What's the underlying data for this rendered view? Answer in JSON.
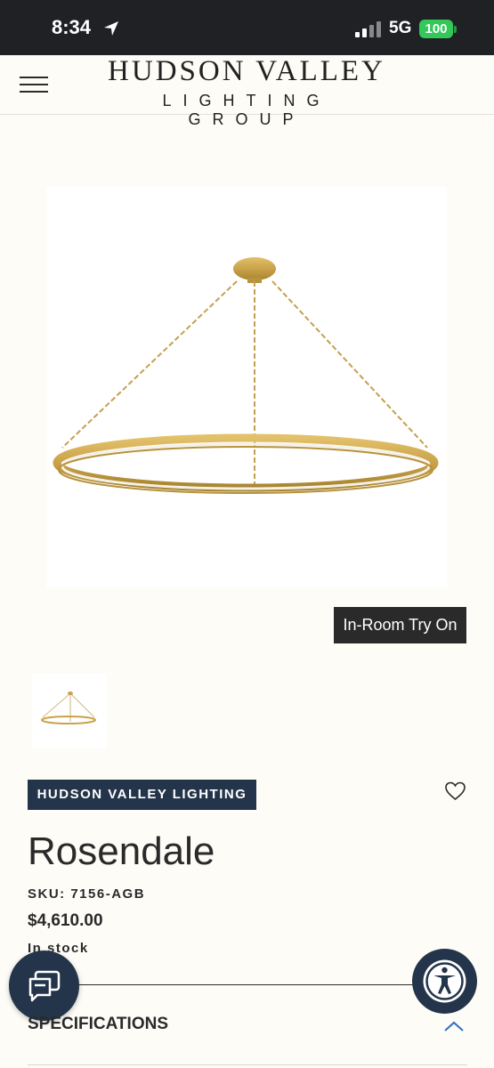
{
  "status_bar": {
    "time": "8:34",
    "network": "5G",
    "battery": "100"
  },
  "header": {
    "brand_top": "HUDSON VALLEY",
    "brand_bottom": "LIGHTING GROUP"
  },
  "product": {
    "try_on_label": "In-Room Try On",
    "brand_badge": "HUDSON VALLEY LIGHTING",
    "name": "Rosendale",
    "sku": "SKU: 7156-AGB",
    "price": "$4,610.00",
    "stock": "In stock"
  },
  "sections": {
    "specifications_label": "SPECIFICATIONS"
  },
  "colors": {
    "status_bar_bg": "#1f2125",
    "page_bg": "#fdfcf7",
    "navy": "#24344a",
    "brass": "#c9a24a",
    "battery_green": "#34c759"
  },
  "icons": [
    "location-arrow-icon",
    "signal-icon",
    "menu-icon",
    "heart-icon",
    "chat-icon",
    "accessibility-icon",
    "chevron-up-icon"
  ]
}
